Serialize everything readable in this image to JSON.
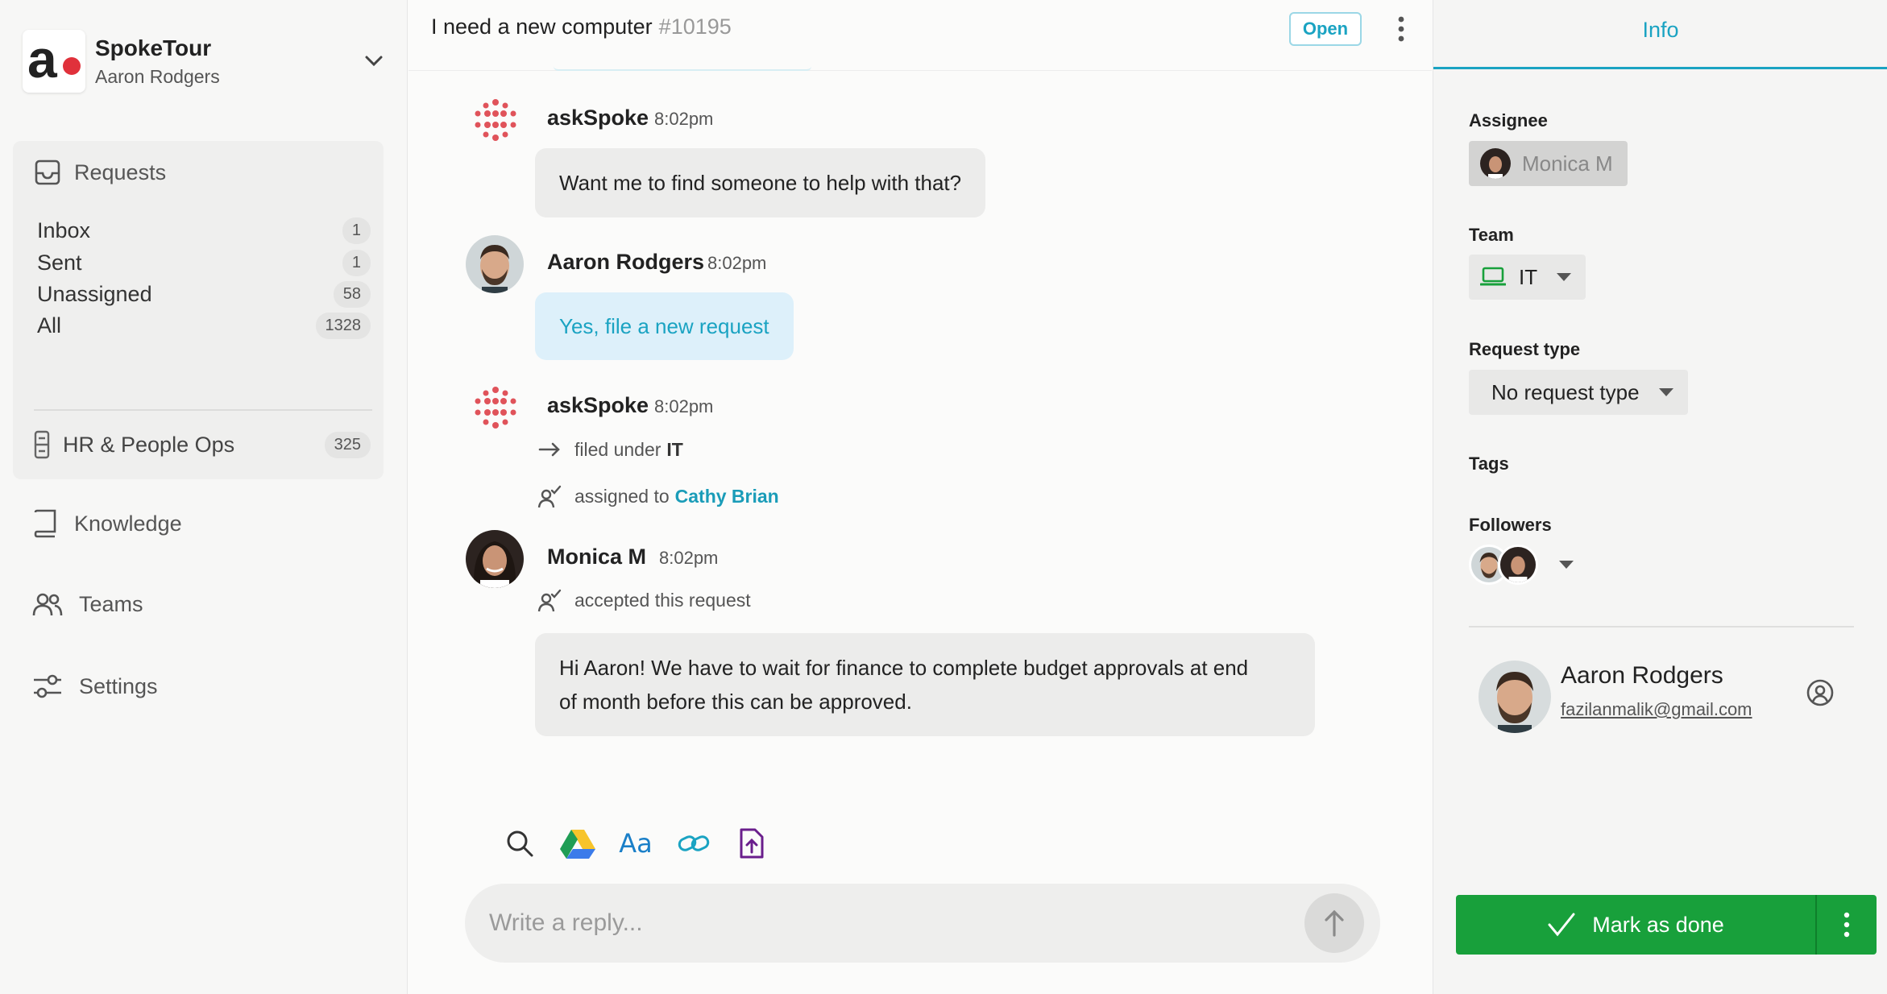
{
  "org": {
    "name": "SpokeTour",
    "user": "Aaron Rodgers",
    "logo_letter": "a"
  },
  "sidebar": {
    "requests_label": "Requests",
    "items": [
      {
        "label": "Inbox",
        "count": "1"
      },
      {
        "label": "Sent",
        "count": "1"
      },
      {
        "label": "Unassigned",
        "count": "58"
      },
      {
        "label": "All",
        "count": "1328"
      }
    ],
    "hr": {
      "label": "HR & People Ops",
      "count": "325"
    },
    "knowledge": "Knowledge",
    "teams": "Teams",
    "settings": "Settings"
  },
  "header": {
    "title": "I need a new computer",
    "number": "#10195",
    "status": "Open"
  },
  "messages": {
    "m1": {
      "author": "askSpoke",
      "time": "8:02pm",
      "text": "Want me to find someone to help with that?"
    },
    "m2": {
      "author": "Aaron Rodgers",
      "time": "8:02pm",
      "text": "Yes, file a new request"
    },
    "m3": {
      "author": "askSpoke",
      "time": "8:02pm",
      "event1_prefix": "filed under",
      "event1_value": "IT",
      "event2_prefix": "assigned to",
      "event2_value": "Cathy Brian"
    },
    "m4": {
      "author": "Monica M",
      "time": "8:02pm",
      "event": "accepted this request",
      "text_line1": "Hi Aaron! We have to wait for finance to complete budget approvals at end",
      "text_line2": "of month before this can be approved."
    }
  },
  "composer": {
    "placeholder": "Write a reply...",
    "aa_label": "Aa"
  },
  "info": {
    "tab": "Info",
    "assignee_label": "Assignee",
    "assignee": "Monica M",
    "team_label": "Team",
    "team": "IT",
    "request_type_label": "Request type",
    "request_type": "No request type",
    "tags_label": "Tags",
    "followers_label": "Followers",
    "contact_name": "Aaron Rodgers",
    "contact_email": "fazilanmalik@gmail.com",
    "done_label": "Mark as done"
  },
  "colors": {
    "accent": "#1aa3c2",
    "brand_red": "#e0313b",
    "done_green": "#18a03b"
  }
}
